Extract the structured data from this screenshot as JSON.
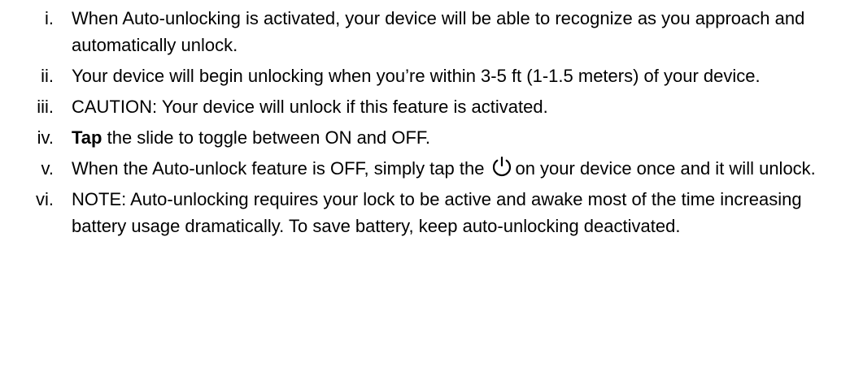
{
  "list": {
    "items": [
      {
        "num": "i.",
        "text": "When Auto-unlocking is activated, your device will be able to recognize as you approach and automatically unlock."
      },
      {
        "num": "ii.",
        "text": "Your device will begin unlocking when you’re within 3-5 ft (1-1.5 meters) of your device."
      },
      {
        "num": "iii.",
        "text": "CAUTION: Your device will unlock if this feature is activated."
      },
      {
        "num": "iv.",
        "bold": "Tap",
        "text": " the slide to toggle between ON and OFF."
      },
      {
        "num": "v.",
        "text_before": "When the Auto-unlock feature is OFF, simply tap the",
        "icon": "power-icon",
        "text_after": "on your device once and it will unlock."
      },
      {
        "num": "vi.",
        "text": "NOTE: Auto-unlocking requires your lock to be active and awake most of the time increasing battery usage dramatically. To save battery, keep auto-unlocking deactivated."
      }
    ]
  }
}
